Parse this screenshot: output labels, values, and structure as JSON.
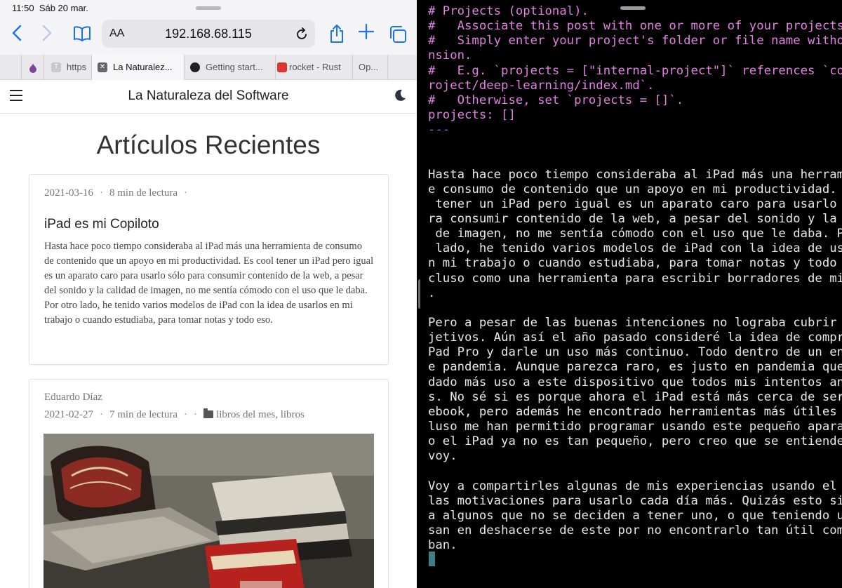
{
  "status_bar": {
    "time": "11:50",
    "date": "Sáb 20 mar."
  },
  "safari": {
    "text_size_label": "AA",
    "url": "192.168.68.115",
    "tabs": [
      {
        "label": "https"
      },
      {
        "label": "La Naturalez..."
      },
      {
        "label": "Getting start..."
      },
      {
        "label": "rocket - Rust"
      },
      {
        "label": "Op..."
      }
    ],
    "site_title": "La Naturaleza del Software",
    "page_heading": "Artículos Recientes",
    "posts": [
      {
        "date": "2021-03-16",
        "reading_time": "8 min de lectura",
        "title": "iPad es mi Copiloto",
        "summary": "Hasta hace poco tiempo consideraba al iPad más una herramienta de consumo de contenido que un apoyo en mi productividad. Es cool tener un iPad pero igual es un aparato caro para usarlo sólo para consumir contenido de la web, a pesar del sonido y la calidad de imagen, no me sentía cómodo con el uso que le daba. Por otro lado, he tenido varios modelos de iPad con la idea de usarlos en mi trabajo o cuando estudiaba, para tomar notas y todo eso."
      },
      {
        "author": "Eduardo Díaz",
        "date": "2021-02-27",
        "reading_time": "7 min de lectura",
        "categories": "libros del mes, libros"
      }
    ]
  },
  "editor": {
    "lines": [
      {
        "text": "# Projects (optional).",
        "style": "fm"
      },
      {
        "text": "#   Associate this post with one or more of your projects.",
        "style": "fm"
      },
      {
        "text": "#   Simply enter your project's folder or file name without exte",
        "style": "fm"
      },
      {
        "text": "nsion.",
        "style": "fm"
      },
      {
        "text": "#   E.g. `projects = [\"internal-project\"]` references `content/p",
        "style": "fm"
      },
      {
        "text": "roject/deep-learning/index.md`.",
        "style": "fm"
      },
      {
        "text": "#   Otherwise, set `projects = []`.",
        "style": "fm"
      },
      {
        "text": "projects: []",
        "style": "fm"
      },
      {
        "text": "---",
        "style": "sep"
      },
      {
        "text": "",
        "style": ""
      },
      {
        "text": "",
        "style": ""
      },
      {
        "text": "Hasta hace poco tiempo consideraba al iPad más una herramienta d",
        "style": ""
      },
      {
        "text": "e consumo de contenido que un apoyo en mi productividad. Es cool",
        "style": ""
      },
      {
        "text": " tener un iPad pero igual es un aparato caro para usarlo sólo pa",
        "style": ""
      },
      {
        "text": "ra consumir contenido de la web, a pesar del sonido y la calidad",
        "style": ""
      },
      {
        "text": " de imagen, no me sentía cómodo con el uso que le daba. Por otro",
        "style": ""
      },
      {
        "text": " lado, he tenido varios modelos de iPad con la idea de usarlos e",
        "style": ""
      },
      {
        "text": "n mi trabajo o cuando estudiaba, para tomar notas y todo eso. In",
        "style": ""
      },
      {
        "text": "cluso como una herramienta para escribir borradores de mis blogs",
        "style": ""
      },
      {
        "text": ".",
        "style": ""
      },
      {
        "text": "",
        "style": ""
      },
      {
        "text": "Pero a pesar de las buenas intenciones no lograba cubrir esos ob",
        "style": ""
      },
      {
        "text": "jetivos. Aún así el año pasado consideré la idea de comprar el i",
        "style": ""
      },
      {
        "text": "Pad Pro y darle un uso más continuo. Todo dentro de un entorno d",
        "style": ""
      },
      {
        "text": "e pandemia. Aunque parezca raro, es justo en pandemia que le he",
        "style": ""
      },
      {
        "text": "dado más uso a este dispositivo que todos mis intentos anteriore",
        "style": ""
      },
      {
        "text": "s. No sé si es porque ahora el iPad está más cerca de ser un not",
        "style": ""
      },
      {
        "text": "ebook, pero además he encontrado herramientas más útiles que inc",
        "style": ""
      },
      {
        "text": "luso me han permitido programar usando este pequeño aparato.Buen",
        "style": ""
      },
      {
        "text": "o el iPad ya no es tan pequeño, pero creo que se entiende a que",
        "style": ""
      },
      {
        "text": "voy.",
        "style": ""
      },
      {
        "text": "",
        "style": ""
      },
      {
        "text": "Voy a compartirles algunas de mis experiencias usando el iPad y",
        "style": ""
      },
      {
        "text": "las motivaciones para usarlo cada día más. Quizás esto sirva par",
        "style": ""
      },
      {
        "text": "a algunos que no se deciden a tener uno, o que teniendo uno pien",
        "style": ""
      },
      {
        "text": "san en deshacerse de este por no encontrarlo tan útil como pensa",
        "style": ""
      },
      {
        "text": "ban.",
        "style": ""
      }
    ]
  },
  "colors": {
    "safari_accent": "#1a73e8",
    "editor_background": "#000000",
    "editor_text": "#e8e8e8",
    "frontmatter": "#e080e0",
    "separator": "#4b7fe0",
    "cursor": "#3f7f86"
  },
  "icons": {
    "back": "chevron-left-icon",
    "forward": "chevron-right-icon",
    "bookmarks": "book-icon",
    "reload": "reload-icon",
    "share": "share-icon",
    "new_tab": "plus-icon",
    "tabs_overview": "tabs-icon",
    "menu": "hamburger-icon",
    "theme": "moon-icon",
    "category": "folder-icon"
  }
}
